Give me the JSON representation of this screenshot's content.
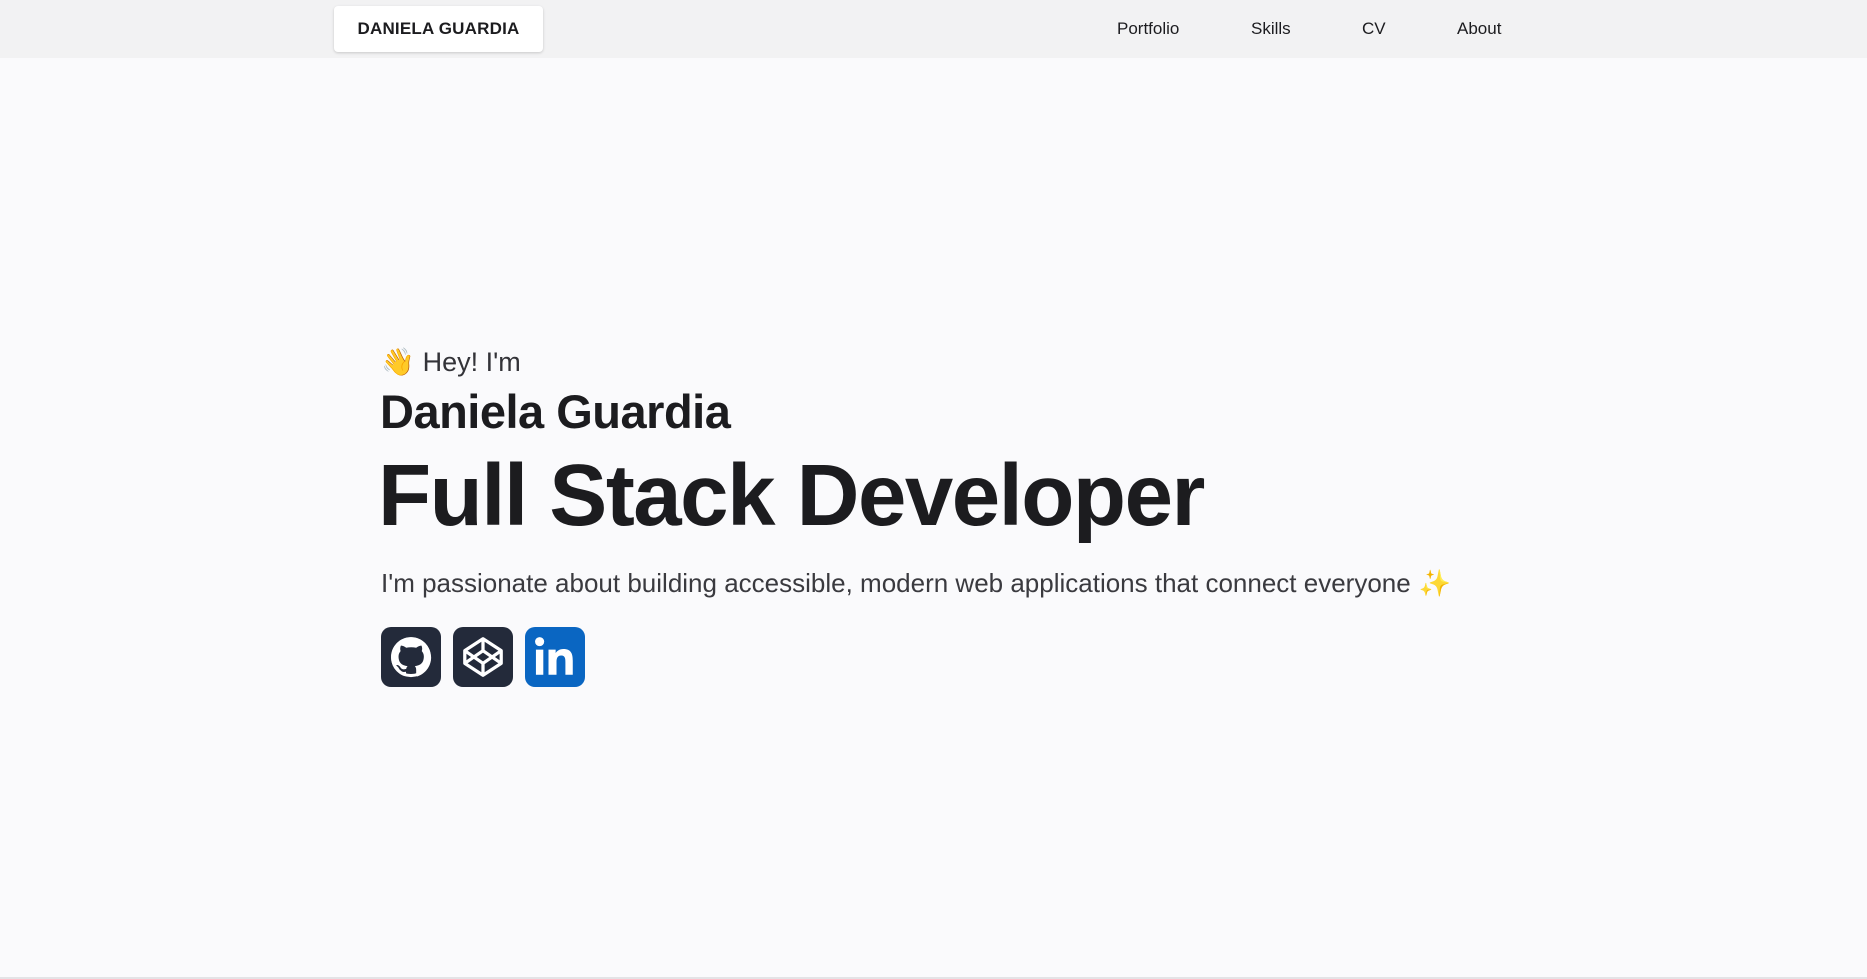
{
  "header": {
    "brand": "DANIELA GUARDIA",
    "nav": [
      {
        "label": "Portfolio"
      },
      {
        "label": "Skills"
      },
      {
        "label": "CV"
      },
      {
        "label": "About"
      }
    ]
  },
  "hero": {
    "wave_emoji": "👋",
    "greeting": "Hey! I'm",
    "name": "Daniela Guardia",
    "role": "Full Stack Developer",
    "tagline": "I'm passionate about building accessible, modern web applications that connect everyone",
    "sparkle_emoji": "✨"
  },
  "socials": [
    {
      "icon": "github-icon",
      "color": "#232a3a"
    },
    {
      "icon": "codepen-icon",
      "color": "#232a3a"
    },
    {
      "icon": "linkedin-icon",
      "color": "#0a66c2"
    }
  ],
  "colors": {
    "background": "#fafafc",
    "header_background": "#f2f2f3",
    "text": "#1c1c1f",
    "linkedin_blue": "#0a66c2",
    "dark_icon": "#232a3a"
  }
}
